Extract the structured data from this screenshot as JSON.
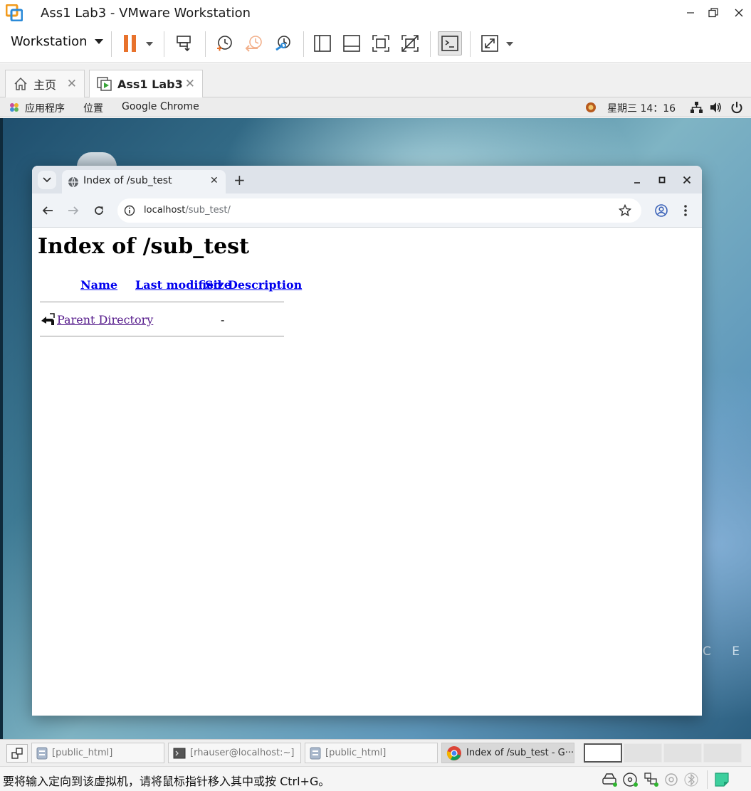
{
  "window": {
    "title": "Ass1 Lab3 - VMware Workstation"
  },
  "toolbar": {
    "workstation_menu": "Workstation"
  },
  "vm_tabs": [
    {
      "label": "主页"
    },
    {
      "label": "Ass1 Lab3"
    }
  ],
  "guest_top": {
    "apps": "应用程序",
    "places": "位置",
    "active_app": "Google Chrome",
    "clock": "星期三 14：16"
  },
  "chrome": {
    "tab_title": "Index of /sub_test",
    "url_host": "localhost",
    "url_path": "/sub_test/"
  },
  "page": {
    "heading": "Index of /sub_test",
    "columns": [
      "Name",
      "Last modified",
      "Size",
      "Description"
    ],
    "rows": [
      {
        "name": "Parent Directory",
        "last_modified": "",
        "size": "-",
        "description": ""
      }
    ]
  },
  "desktop": {
    "watermark": "C E"
  },
  "taskbar": {
    "items": [
      {
        "label": "[public_html]",
        "icon": "file-manager-icon"
      },
      {
        "label": "[rhauser@localhost:~]",
        "icon": "terminal-icon"
      },
      {
        "label": "[public_html]",
        "icon": "file-manager-icon"
      },
      {
        "label": "Index of /sub_test - G···",
        "icon": "chrome-icon"
      }
    ]
  },
  "status_bar": {
    "text": "要将输入定向到该虚拟机，请将鼠标指针移入其中或按 Ctrl+G。"
  },
  "colors": {
    "accent_orange": "#e8722c",
    "link_blue": "#0000ee",
    "visited_purple": "#551a8b"
  }
}
